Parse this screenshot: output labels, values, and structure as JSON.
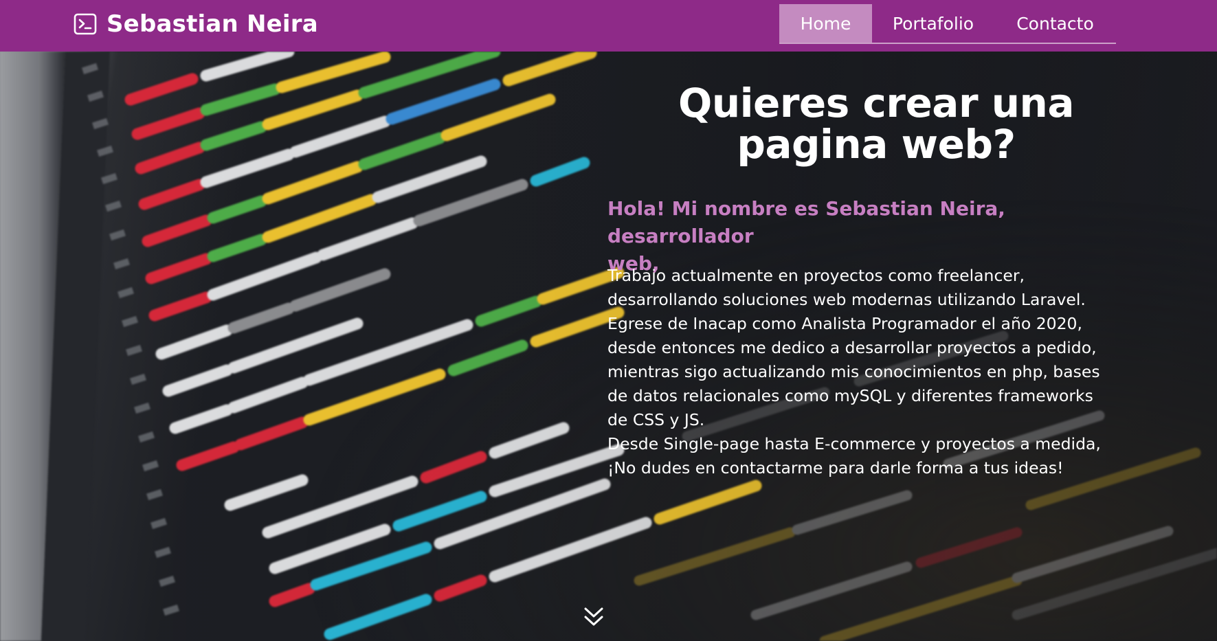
{
  "brand": {
    "icon": "terminal-icon",
    "name": "Sebastian Neira"
  },
  "nav": {
    "items": [
      {
        "label": "Home",
        "active": true
      },
      {
        "label": "Portafolio",
        "active": false
      },
      {
        "label": "Contacto",
        "active": false
      }
    ]
  },
  "hero": {
    "title_line1": "Quieres crear una",
    "title_line2": "pagina web?",
    "intro_line1": "Hola! Mi nombre es Sebastian Neira, desarrollador",
    "intro_line2": "web,",
    "bio_lines": [
      "Trabajo actualmente en proyectos como freelancer,",
      "desarrollando soluciones web modernas utilizando Laravel.",
      "Egrese de Inacap como Analista Programador el año 2020,",
      "desde entonces me dedico a desarrollar proyectos a pedido,",
      "mientras sigo actualizando mis conocimientos en php, bases",
      "de datos relacionales como mySQL y diferentes frameworks",
      "de CSS y JS.",
      "Desde Single-page hasta E-commerce y proyectos a medida,",
      "¡No dudes en contactarme para darle forma a tus ideas!"
    ],
    "scroll_icon": "chevron-double-down-icon",
    "background_image": "blurred-code-editor-screen"
  },
  "colors": {
    "navbar": "#8e2a88",
    "nav_active": "#c48bc0",
    "intro_text": "#c77fc2",
    "text": "#ffffff"
  }
}
